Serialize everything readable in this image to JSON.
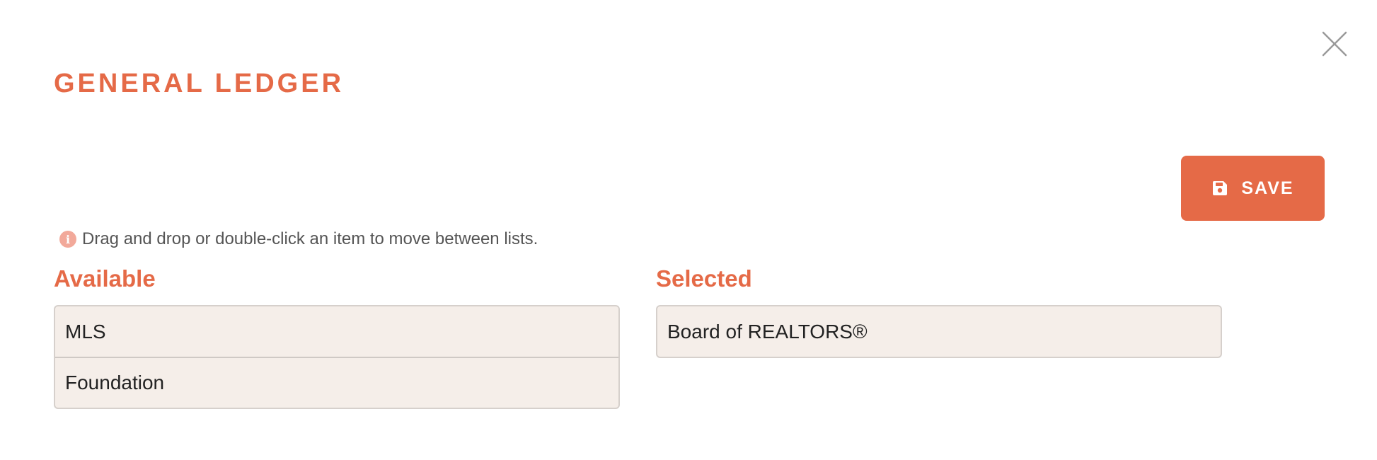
{
  "header": {
    "title": "GENERAL LEDGER"
  },
  "icons": {
    "close": "close-icon",
    "save": "floppy-disk-icon",
    "info": "info-icon"
  },
  "toolbar": {
    "save_label": "SAVE"
  },
  "hint": {
    "icon_glyph": "i",
    "text": "Drag and drop or double-click an item to move between lists."
  },
  "available": {
    "heading": "Available",
    "items": [
      {
        "label": "MLS"
      },
      {
        "label": "Foundation"
      }
    ]
  },
  "selected": {
    "heading": "Selected",
    "items": [
      {
        "label": "Board of REALTORS®"
      }
    ]
  },
  "colors": {
    "accent": "#e56a47",
    "list_bg": "#f5eee9",
    "hint_icon": "#f2a99a",
    "hint_text": "#555555"
  }
}
